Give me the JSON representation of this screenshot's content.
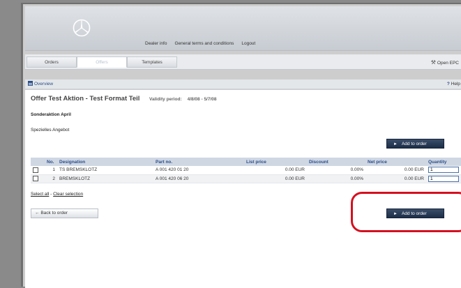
{
  "header": {
    "logo_icon": "mercedes-star-icon",
    "nav": [
      "Dealer info",
      "General terms and conditions",
      "Logout"
    ]
  },
  "tabs": [
    {
      "label": "Orders",
      "active": false
    },
    {
      "label": "Offers",
      "active": true
    },
    {
      "label": "Templates",
      "active": false
    }
  ],
  "open_epc": {
    "icon": "wrench-icon",
    "label": "Open EPC"
  },
  "breadcrumb": {
    "overview": "Overview",
    "help_mark": "?",
    "help": "Help"
  },
  "offer": {
    "title": "Offer Test Aktion - Test Format Teil",
    "validity_label": "Validity period:",
    "validity_value": "4/8/08 - 5/7/08",
    "subtitle": "Sonderaktion April",
    "description": "Spezielles Angebot"
  },
  "add_to_order_label": "Add to order",
  "table": {
    "columns": [
      "No.",
      "Designation",
      "Part no.",
      "List price",
      "Discount",
      "Net price",
      "Quantity"
    ],
    "rows": [
      {
        "no": "1",
        "designation": "TS BREMSKLOTZ",
        "part_no": "A 001 420 01 20",
        "list_price": "0.00 EUR",
        "discount": "0.00%",
        "net_price": "0.00 EUR",
        "quantity": "1"
      },
      {
        "no": "2",
        "designation": "BREMSKLOTZ",
        "part_no": "A 001 420 06 20",
        "list_price": "0.00 EUR",
        "discount": "0.00%",
        "net_price": "0.00 EUR",
        "quantity": "1"
      }
    ]
  },
  "selection": {
    "select_all": "Select all",
    "separator": " - ",
    "clear": "Clear selection"
  },
  "back_button": "Back to order",
  "colors": {
    "accent": "#2a4e8a",
    "button_dark": "#1c2d47",
    "highlight": "#d5101f"
  }
}
